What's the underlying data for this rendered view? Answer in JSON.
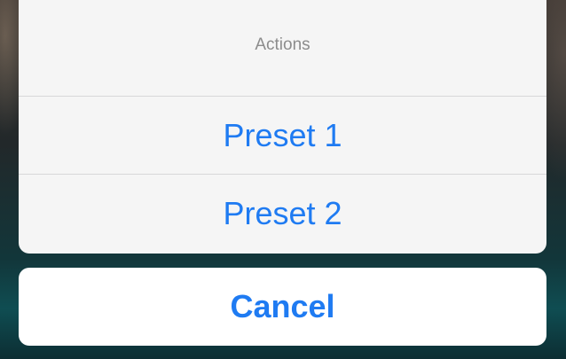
{
  "action_sheet": {
    "title": "Actions",
    "options": [
      {
        "label": "Preset 1"
      },
      {
        "label": "Preset 2"
      }
    ],
    "cancel_label": "Cancel"
  },
  "colors": {
    "accent": "#1f7bf2",
    "title_text": "#8c8c8c",
    "sheet_background": "#f5f5f5",
    "separator": "#d7d7d9",
    "cancel_background": "#ffffff"
  }
}
